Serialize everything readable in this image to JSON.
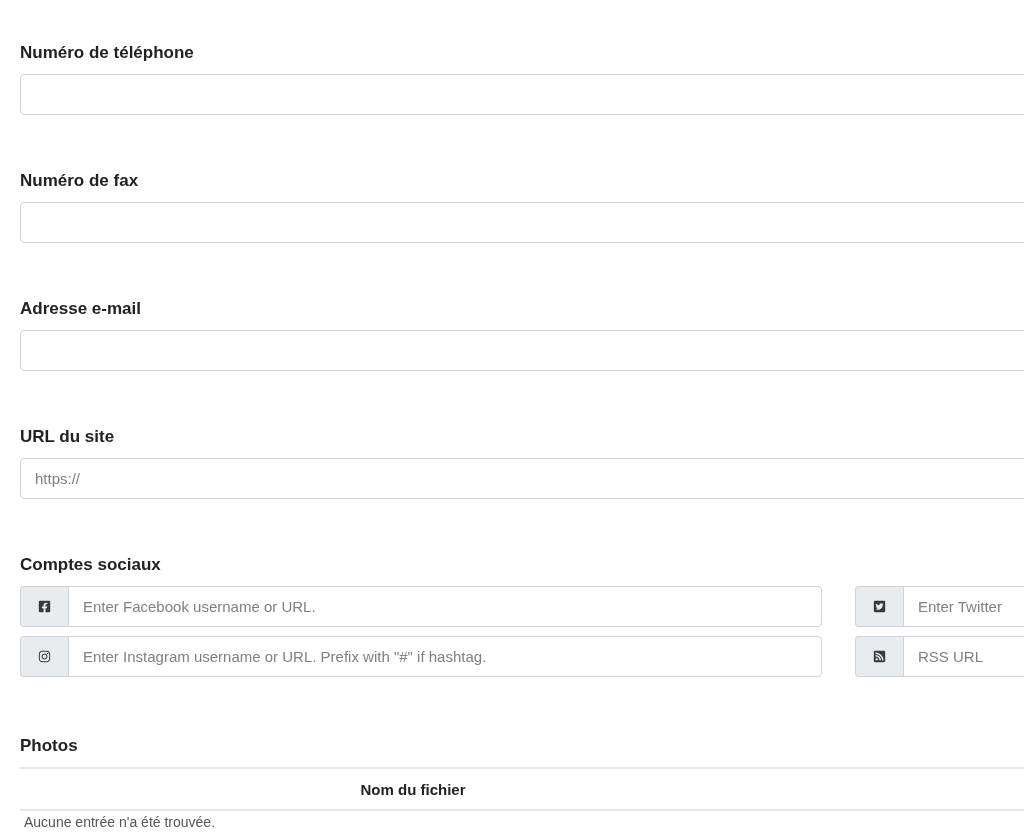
{
  "fields": [
    {
      "label": "Numéro de téléphone"
    },
    {
      "label": "Numéro de fax"
    },
    {
      "label": "Adresse e-mail"
    },
    {
      "label": "URL du site",
      "placeholder": "https://"
    }
  ],
  "social": {
    "label": "Comptes sociaux",
    "accounts": [
      {
        "kind": "facebook",
        "placeholder": "Enter Facebook username or URL."
      },
      {
        "kind": "twitter",
        "placeholder": "Enter Twitter"
      },
      {
        "kind": "instagram",
        "placeholder": "Enter Instagram username or URL. Prefix with \"#\" if hashtag."
      },
      {
        "kind": "rss",
        "placeholder": "RSS URL"
      }
    ]
  },
  "photos": {
    "label": "Photos",
    "columns": [
      "Nom du fichier"
    ],
    "empty_text": "Aucune entrée n'a été trouvée."
  }
}
